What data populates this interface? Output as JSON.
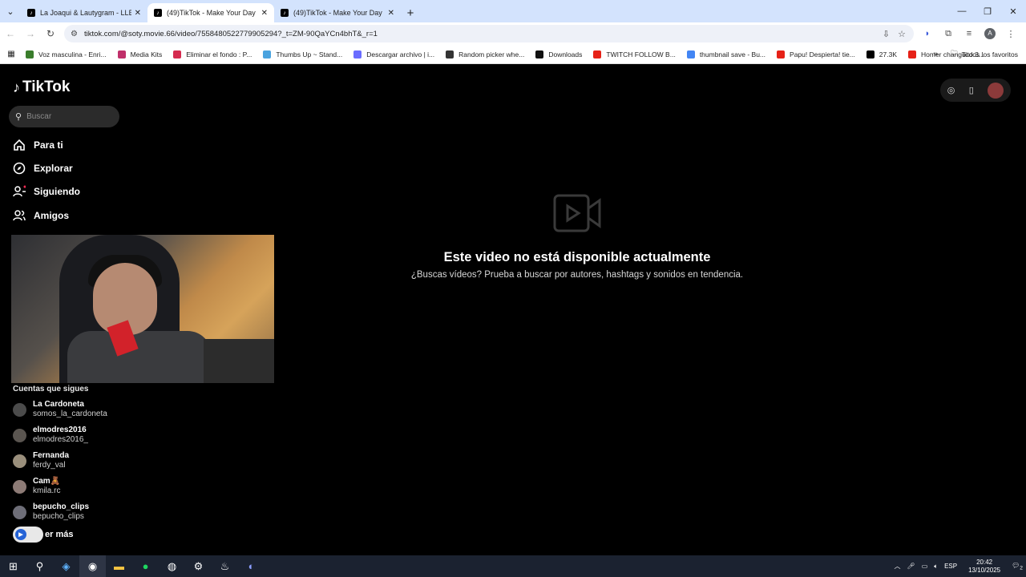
{
  "browser": {
    "tabs": [
      {
        "title": "La Joaqui & Lautygram - LLEGUÉ",
        "active": false
      },
      {
        "title": "(49)TikTok - Make Your Day",
        "active": true
      },
      {
        "title": "(49)TikTok - Make Your Day",
        "active": false
      }
    ],
    "new_tab": "+",
    "url": "tiktok.com/@soty.movie.66/video/7558480522779905294?_t=ZM-90QaYCn4bhT&_r=1",
    "bookmarks": [
      {
        "label": "Voz masculina - Enri...",
        "color": "#3a7d2c"
      },
      {
        "label": "Media Kits",
        "color": "#c0306a"
      },
      {
        "label": "Eliminar el fondo : P...",
        "color": "#d52b4f"
      },
      {
        "label": "Thumbs Up ~ Stand...",
        "color": "#4aa3df"
      },
      {
        "label": "Descargar archivo | i...",
        "color": "#6a6cff"
      },
      {
        "label": "Random picker whe...",
        "color": "#333333"
      },
      {
        "label": "Downloads",
        "color": "#111111"
      },
      {
        "label": "TWITCH FOLLOW B...",
        "color": "#e62117"
      },
      {
        "label": "thumbnail save - Bu...",
        "color": "#4285f4"
      },
      {
        "label": "Papu! Despierta! tie...",
        "color": "#e62117"
      },
      {
        "label": "27.3K",
        "color": "#000000"
      },
      {
        "label": "Homer changuito.3...",
        "color": "#e62117"
      }
    ],
    "bookmarks_more": "»",
    "all_bookmarks": "Todos los favoritos"
  },
  "tiktok": {
    "logo": "TikTok",
    "search_placeholder": "Buscar",
    "nav": [
      {
        "label": "Para ti",
        "icon": "home-icon"
      },
      {
        "label": "Explorar",
        "icon": "compass-icon"
      },
      {
        "label": "Siguiendo",
        "icon": "user-follow-icon"
      },
      {
        "label": "Amigos",
        "icon": "friends-icon"
      }
    ],
    "following_title": "Cuentas que sigues",
    "accounts": [
      {
        "name": "La Cardoneta",
        "handle": "somos_la_cardoneta"
      },
      {
        "name": "elmodres2016",
        "handle": "elmodres2016_"
      },
      {
        "name": "Fernanda",
        "handle": "ferdy_val"
      },
      {
        "name": "Cam🧸",
        "handle": "kmila.rc"
      },
      {
        "name": "bepucho_clips",
        "handle": "bepucho_clips"
      }
    ],
    "see_more": "er más",
    "unavailable_title": "Este video no está disponible actualmente",
    "unavailable_sub": "¿Buscas vídeos? Prueba a buscar por autores, hashtags y sonidos en tendencia."
  },
  "taskbar": {
    "lang": "ESP",
    "time": "20:42",
    "date": "13/10/2025",
    "notif_count": "2"
  }
}
